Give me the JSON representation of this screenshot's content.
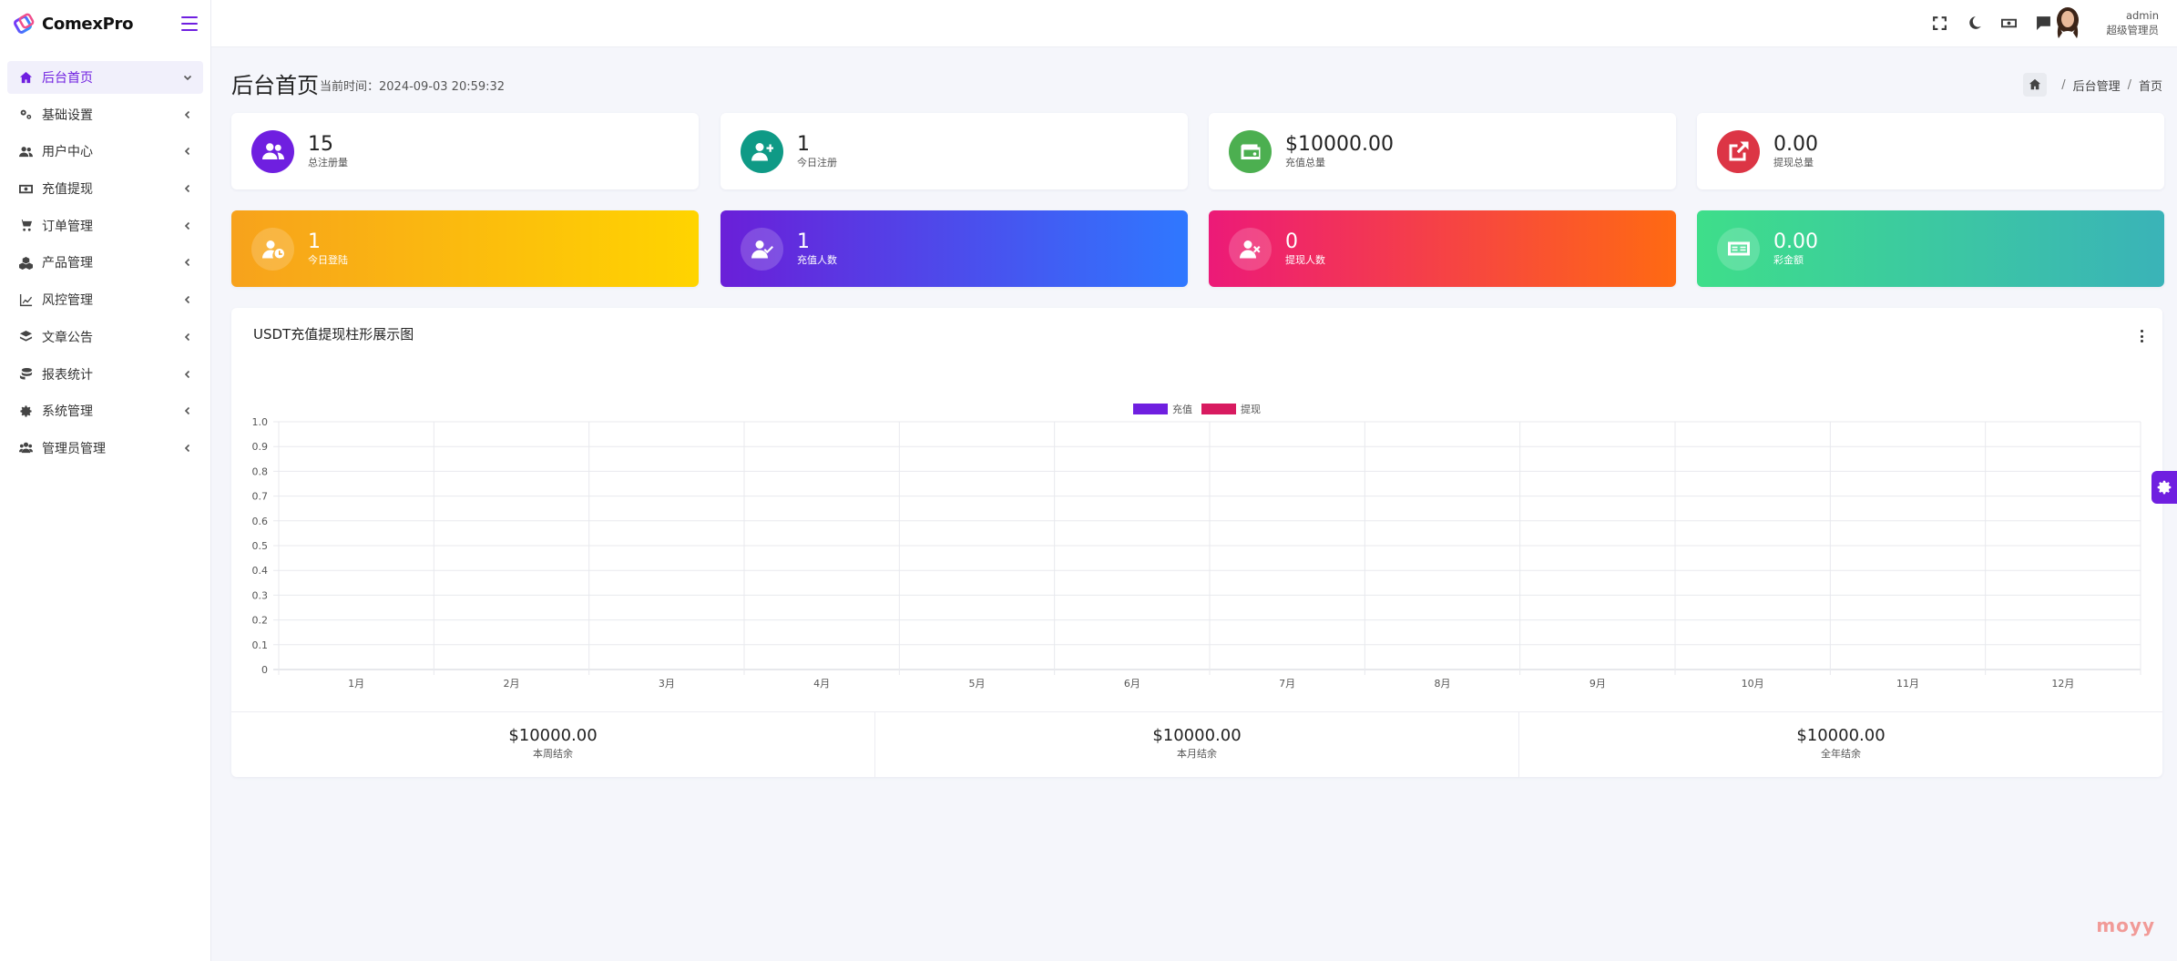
{
  "brand": {
    "name": "ComexPro"
  },
  "sidebar": {
    "items": [
      {
        "label": "后台首页",
        "icon": "home-icon",
        "active": true
      },
      {
        "label": "基础设置",
        "icon": "cogs-icon"
      },
      {
        "label": "用户中心",
        "icon": "users-icon"
      },
      {
        "label": "充值提现",
        "icon": "money-bill-icon"
      },
      {
        "label": "订单管理",
        "icon": "cart-icon"
      },
      {
        "label": "产品管理",
        "icon": "cubes-icon"
      },
      {
        "label": "风控管理",
        "icon": "chart-line-icon"
      },
      {
        "label": "文章公告",
        "icon": "layers-icon"
      },
      {
        "label": "报表统计",
        "icon": "coins-icon"
      },
      {
        "label": "系统管理",
        "icon": "gear-icon"
      },
      {
        "label": "管理员管理",
        "icon": "user-group-icon"
      }
    ]
  },
  "topbar": {
    "icons": [
      "fullscreen-icon",
      "moon-icon",
      "money-icon",
      "message-icon"
    ],
    "user": {
      "name": "admin",
      "role": "超级管理员"
    }
  },
  "page": {
    "title": "后台首页",
    "time_label": "当前时间：2024-09-03 20:59:32",
    "breadcrumb": [
      "后台管理",
      "首页"
    ]
  },
  "stats_row1": [
    {
      "value": "15",
      "label": "总注册量",
      "color": "#6f1fe0",
      "icon": "users-icon"
    },
    {
      "value": "1",
      "label": "今日注册",
      "color": "#0f9a86",
      "icon": "user-plus-icon"
    },
    {
      "value": "$10000.00",
      "label": "充值总量",
      "color": "#4caf50",
      "icon": "wallet-icon"
    },
    {
      "value": "0.00",
      "label": "提现总量",
      "color": "#dc3545",
      "icon": "external-link-icon"
    }
  ],
  "stats_row2": [
    {
      "value": "1",
      "label": "今日登陆",
      "gradient": [
        "#f7a21c",
        "#ffd400"
      ],
      "icon": "user-clock-icon"
    },
    {
      "value": "1",
      "label": "充值人数",
      "gradient": [
        "#6a1fd8",
        "#2f78ff"
      ],
      "icon": "user-check-icon"
    },
    {
      "value": "0",
      "label": "提现人数",
      "gradient": [
        "#ec1a78",
        "#ff6a12"
      ],
      "icon": "user-times-icon"
    },
    {
      "value": "0.00",
      "label": "彩金额",
      "gradient": [
        "#3ede8a",
        "#3ab3b8"
      ],
      "icon": "money-check-icon"
    }
  ],
  "chart": {
    "title": "USDT充值提现柱形展示图"
  },
  "chart_data": {
    "type": "bar",
    "title": "USDT充值提现柱形展示图",
    "categories": [
      "1月",
      "2月",
      "3月",
      "4月",
      "5月",
      "6月",
      "7月",
      "8月",
      "9月",
      "10月",
      "11月",
      "12月"
    ],
    "series": [
      {
        "name": "充值",
        "color": "#6f1fe0",
        "values": [
          0,
          0,
          0,
          0,
          0,
          0,
          0,
          0,
          0,
          0,
          0,
          0
        ]
      },
      {
        "name": "提现",
        "color": "#d81b60",
        "values": [
          0,
          0,
          0,
          0,
          0,
          0,
          0,
          0,
          0,
          0,
          0,
          0
        ]
      }
    ],
    "ylim": [
      0,
      1.0
    ],
    "yticks": [
      "0",
      "0.1",
      "0.2",
      "0.3",
      "0.4",
      "0.5",
      "0.6",
      "0.7",
      "0.8",
      "0.9",
      "1.0"
    ],
    "legend": "top-center",
    "grid": true
  },
  "summary": [
    {
      "value": "$10000.00",
      "label": "本周结余"
    },
    {
      "value": "$10000.00",
      "label": "本月结余"
    },
    {
      "value": "$10000.00",
      "label": "全年结余"
    }
  ],
  "watermark": "moyy"
}
